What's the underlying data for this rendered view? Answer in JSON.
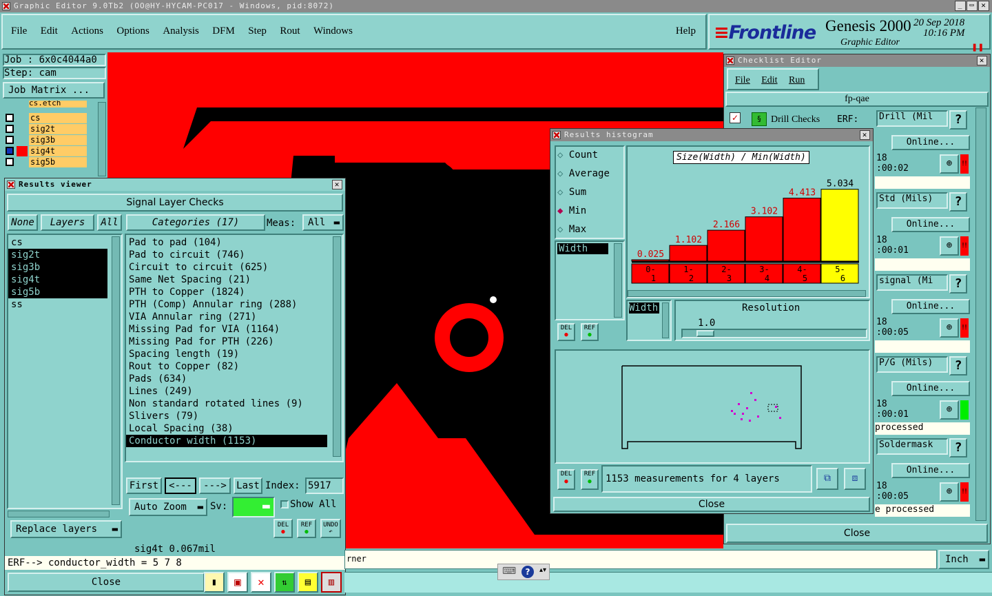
{
  "app": {
    "title": "Graphic Editor 9.0Tb2 (OO@HY-HYCAM-PC017 - Windows, pid:8072)",
    "brand": "Frontline",
    "product": "Genesis 2000",
    "subtitle": "Graphic Editor",
    "date": "20 Sep 2018",
    "time": "10:16 PM"
  },
  "menu": [
    "File",
    "Edit",
    "Actions",
    "Options",
    "Analysis",
    "DFM",
    "Step",
    "Rout",
    "Windows"
  ],
  "help": "Help",
  "job": {
    "job_label": "Job : 6x0c4044a0",
    "step_label": "Step: cam",
    "matrix_btn": "Job Matrix ..."
  },
  "layer_panel": {
    "top": "cs.etch",
    "rows": [
      "cs",
      "sig2t",
      "sig3b",
      "sig4t",
      "sig5b"
    ]
  },
  "results_viewer": {
    "title": "Results viewer",
    "header": "Signal Layer Checks",
    "none": "None",
    "layers": "Layers",
    "all": "All",
    "categories_btn": "Categories (17)",
    "meas_label": "Meas:",
    "meas_value": "All",
    "layer_list": [
      "cs",
      "sig2t",
      "sig3b",
      "sig4t",
      "sig5b",
      "ss"
    ],
    "categories": [
      "Pad to pad (104)",
      "Pad to circuit (746)",
      "Circuit to circuit (625)",
      "Same Net Spacing (21)",
      "PTH to Copper (1824)",
      "PTH (Comp) Annular ring (288)",
      "VIA Annular ring (271)",
      "Missing Pad for VIA (1164)",
      "Missing Pad for PTH (226)",
      "Spacing length (19)",
      "Rout to Copper (82)",
      "Pads (634)",
      "Lines (249)",
      "Non standard rotated lines (9)",
      "Slivers (79)",
      "Local Spacing (38)",
      "Conductor width (1153)"
    ],
    "first": "First",
    "prev": "<---",
    "next": "--->",
    "last": "Last",
    "index_label": "Index:",
    "index_value": "5917",
    "auto_zoom": "Auto Zoom",
    "sv_label": "Sv:",
    "show_all": "Show All",
    "replace_layers": "Replace layers",
    "status": "sig4t 0.067mil",
    "erf": "ERF--> conductor_width = 5 7 8",
    "close": "Close",
    "del": "DEL",
    "ref": "REF",
    "undo": "UNDO"
  },
  "histogram": {
    "title": "Results histogram",
    "options": [
      "Count",
      "Average",
      "Sum",
      "Min",
      "Max"
    ],
    "selected": "Min",
    "chart_title": "Size(Width) / Min(Width)",
    "field": "Width",
    "field2": "Width",
    "resolution_label": "Resolution",
    "resolution_value": "1.0",
    "summary": "1153 measurements for 4 layers",
    "close": "Close",
    "del": "DEL",
    "ref": "REF"
  },
  "chart_data": {
    "type": "bar",
    "title": "Size(Width) / Min(Width)",
    "categories": [
      "0-1",
      "1-2",
      "2-3",
      "3-4",
      "4-5",
      "5-6"
    ],
    "values": [
      0.025,
      1.102,
      2.166,
      3.102,
      4.413,
      5.034
    ],
    "labels": [
      "0.025",
      "1.102",
      "2.166",
      "3.102",
      "4.413",
      "5.034"
    ],
    "highlight_index": 5,
    "colors": {
      "bar": "#ff0000",
      "highlight": "#ffff00"
    },
    "ylim": [
      0,
      5.5
    ]
  },
  "checklist": {
    "title": "Checklist Editor",
    "menu": [
      "File",
      "Edit",
      "Run"
    ],
    "name": "fp-qae",
    "drill_checks": "Drill Checks",
    "erf": "ERF:",
    "rows": [
      {
        "name": "Drill (Mil",
        "online": "Online...",
        "num": "18",
        "time": ":00:02",
        "status": "",
        "flag": "#ff0000"
      },
      {
        "name": "Std (Mils)",
        "online": "Online...",
        "num": "18",
        "time": ":00:01",
        "status": "",
        "flag": "#ff0000"
      },
      {
        "name": "signal (Mi",
        "online": "Online...",
        "num": "18",
        "time": ":00:05",
        "status": "",
        "flag": "#ff0000"
      },
      {
        "name": "P/G (Mils)",
        "online": "Online...",
        "num": "18",
        "time": ":00:01",
        "status": "processed",
        "flag": "#00ee00"
      },
      {
        "name": "Soldermask",
        "online": "Online...",
        "num": "18",
        "time": ":00:05",
        "status": "e processed",
        "flag": "#ff0000"
      }
    ],
    "help": "?",
    "close": "Close"
  },
  "bottom": {
    "command_text": "rner",
    "units": "Inch"
  }
}
